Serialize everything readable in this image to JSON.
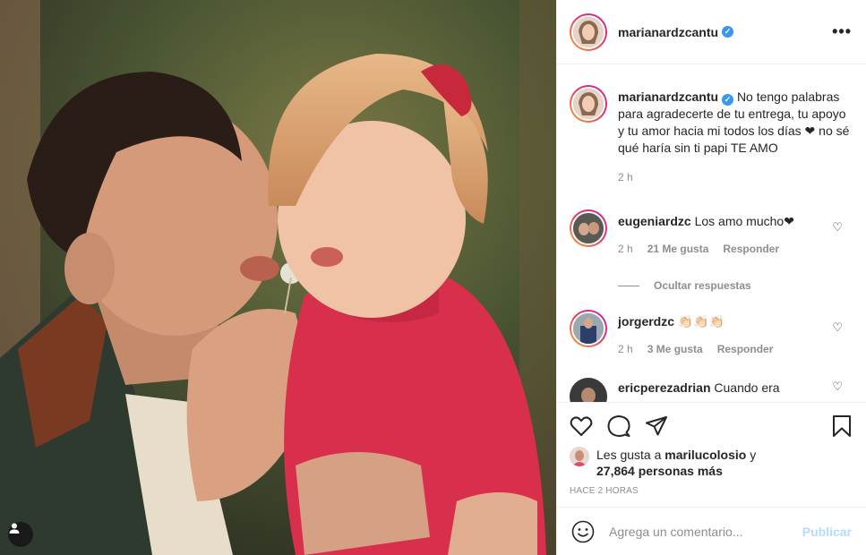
{
  "post": {
    "username": "marianardzcantu",
    "verified_mark": "✓",
    "more_icon": "•••",
    "caption": "No tengo palabras para agradecerte de tu entrega, tu apoyo y tu amor hacia mi todos los días ❤ no sé qué haría sin ti papi TE AMO",
    "caption_time": "2 h"
  },
  "comments": [
    {
      "username": "eugeniardzc",
      "text": "Los amo mucho❤",
      "time": "2 h",
      "likes": "21 Me gusta",
      "reply": "Responder"
    },
    {
      "username": "jorgerdzc",
      "text": "👏🏻👏🏻👏🏻",
      "time": "2 h",
      "likes": "3 Me gusta",
      "reply": "Responder"
    },
    {
      "username": "ericperezadrian",
      "text": "Cuando era"
    }
  ],
  "hide_replies": "Ocultar respuestas",
  "likes": {
    "prefix": "Les gusta a",
    "user": "marilucolosio",
    "conj": "y",
    "count": "27,864 personas más"
  },
  "timestamp": "HACE 2 HORAS",
  "add_comment": {
    "placeholder": "Agrega un comentario...",
    "publish": "Publicar"
  },
  "colors": {
    "accent_blue": "#3897f0",
    "publish_disabled": "#b3dbff",
    "heart_red": "#ed4956",
    "sweater_red": "#d8304c"
  }
}
